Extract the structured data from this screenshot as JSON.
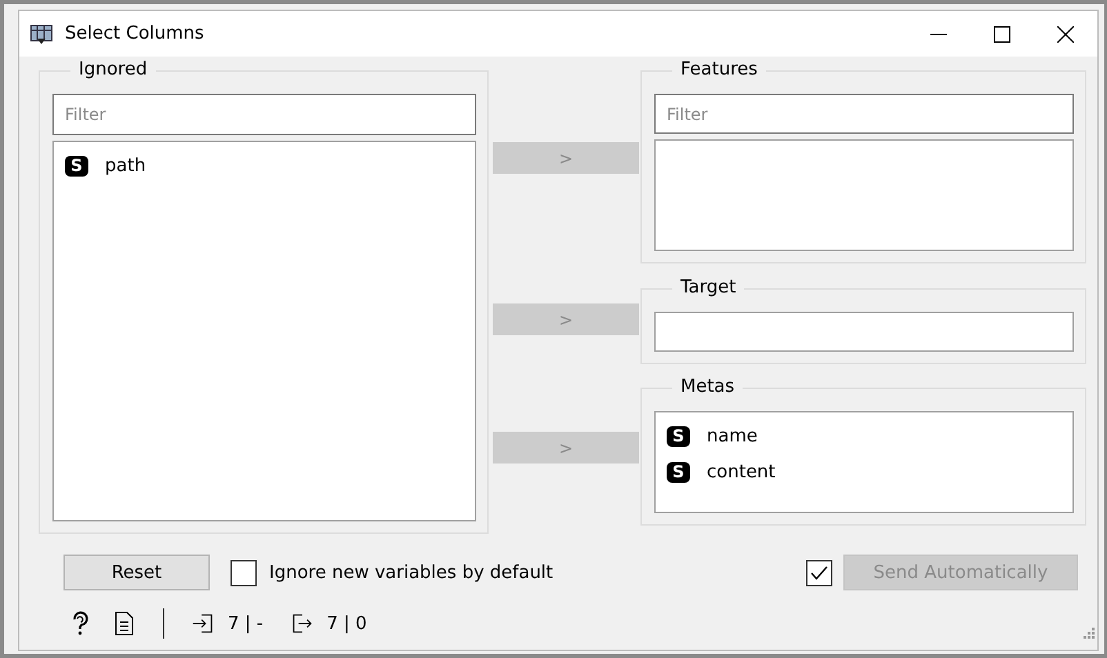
{
  "window": {
    "title": "Select Columns"
  },
  "ignored": {
    "title": "Ignored",
    "filter": {
      "placeholder": "Filter"
    },
    "items": [
      {
        "badge": "S",
        "name": "path"
      }
    ]
  },
  "move_buttons": [
    {
      "label": ">",
      "disabled": true
    },
    {
      "label": ">",
      "disabled": true
    },
    {
      "label": ">",
      "disabled": true
    }
  ],
  "features": {
    "title": "Features",
    "filter": {
      "placeholder": "Filter"
    }
  },
  "target": {
    "title": "Target"
  },
  "metas": {
    "title": "Metas",
    "items": [
      {
        "badge": "S",
        "name": "name"
      },
      {
        "badge": "S",
        "name": "content"
      }
    ]
  },
  "reset_button": {
    "label": "Reset"
  },
  "ignore_new": {
    "label": "Ignore new variables by default",
    "checked": false
  },
  "send_automatically": {
    "label": "Send Automatically",
    "checked": true,
    "disabled": true
  },
  "status_bar": {
    "input_summary": "7 | -",
    "output_summary": "7 | 0"
  }
}
